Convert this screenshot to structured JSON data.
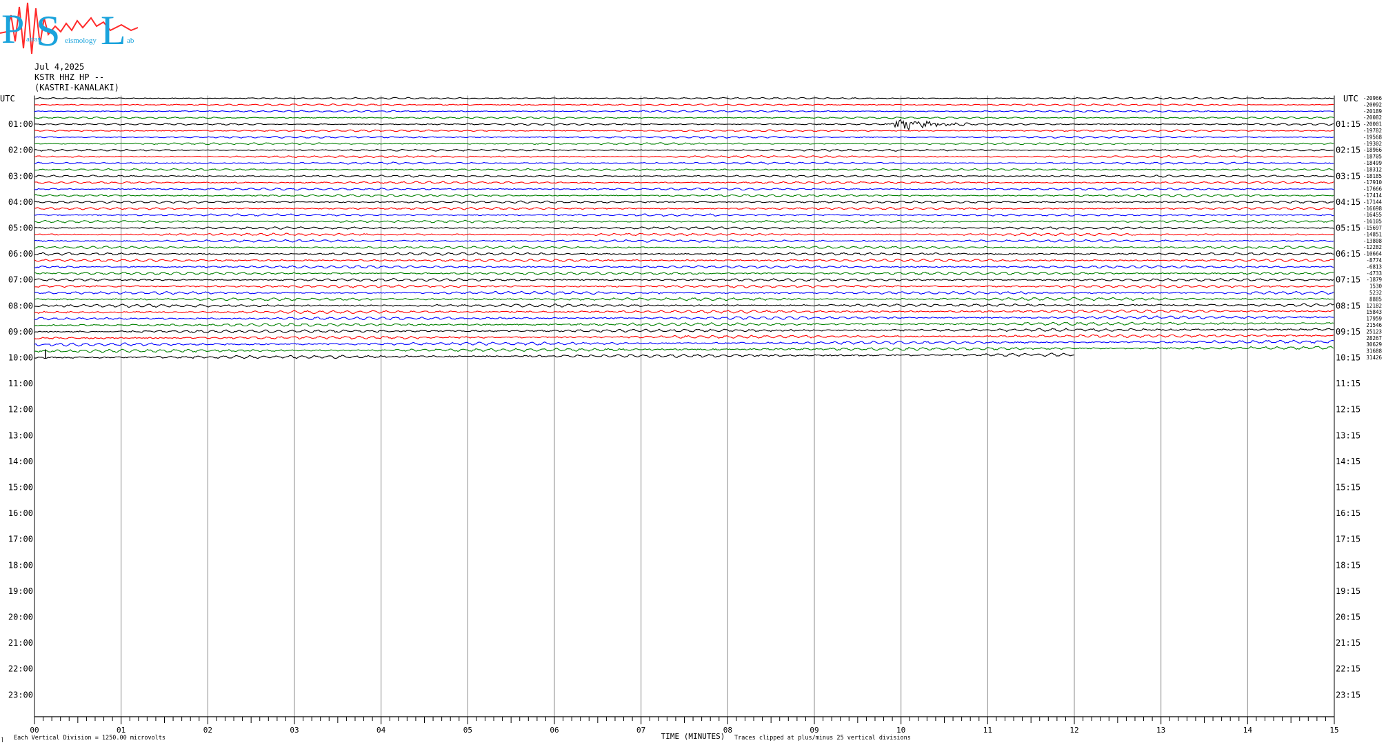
{
  "logo": {
    "letters": [
      "P",
      "S",
      "L"
    ],
    "small_words": [
      "atras",
      "eismology",
      "ab"
    ],
    "colors": {
      "letters": "#1aa3dc",
      "trace": "#ff2a2a"
    }
  },
  "header": {
    "date": "Jul 4,2025",
    "station": "KSTR HHZ HP --",
    "location": "(KASTRI-KANALAKI)"
  },
  "axis": {
    "utc_label": "UTC",
    "left_hours": [
      "01:00",
      "02:00",
      "03:00",
      "04:00",
      "05:00",
      "06:00",
      "07:00",
      "08:00",
      "09:00",
      "10:00",
      "11:00",
      "12:00",
      "13:00",
      "14:00",
      "15:00",
      "16:00",
      "17:00",
      "18:00",
      "19:00",
      "20:00",
      "21:00",
      "22:00",
      "23:00"
    ],
    "right_hours": [
      "01:15",
      "02:15",
      "03:15",
      "04:15",
      "05:15",
      "06:15",
      "07:15",
      "08:15",
      "09:15",
      "10:15",
      "11:15",
      "12:15",
      "13:15",
      "14:15",
      "15:15",
      "16:15",
      "17:15",
      "18:15",
      "19:15",
      "20:15",
      "21:15",
      "22:15",
      "23:15"
    ],
    "minutes": [
      "00",
      "01",
      "02",
      "03",
      "04",
      "05",
      "06",
      "07",
      "08",
      "09",
      "10",
      "11",
      "12",
      "13",
      "14",
      "15"
    ],
    "xlabel": "TIME (MINUTES)"
  },
  "footer": {
    "scale_note": "Each Vertical Division = 1250.00 microvolts",
    "clip_note": "Traces clipped at plus/minus 25 vertical divisions",
    "corner_mark": "⌉"
  },
  "chart_data": {
    "type": "line",
    "title": "",
    "xlabel": "TIME (MINUTES)",
    "xlim": [
      0,
      15
    ],
    "minutes_per_line": 15,
    "lines_total": 96,
    "lines_recorded": 41,
    "series_colors": [
      "#000000",
      "#ff0000",
      "#0000ff",
      "#008000"
    ],
    "trace_offsets": [
      -20966,
      -20092,
      -20189,
      -20082,
      -20001,
      -19782,
      -19568,
      -19302,
      -18966,
      -18705,
      -18499,
      -18312,
      -18185,
      -17910,
      -17666,
      -17414,
      -17144,
      -16698,
      -16455,
      -16105,
      -15697,
      -14851,
      -13808,
      -12282,
      -10664,
      -8774,
      -6813,
      -4733,
      -1879,
      1530,
      5232,
      8885,
      12182,
      15843,
      17959,
      21546,
      25123,
      28267,
      30629,
      31688,
      31426
    ],
    "events": [
      {
        "line": 4,
        "start_min": 9.78,
        "end_min": 10.95,
        "note": "event burst on black trace"
      }
    ],
    "last_line_cutoff_min": 12.0,
    "grid": true
  }
}
